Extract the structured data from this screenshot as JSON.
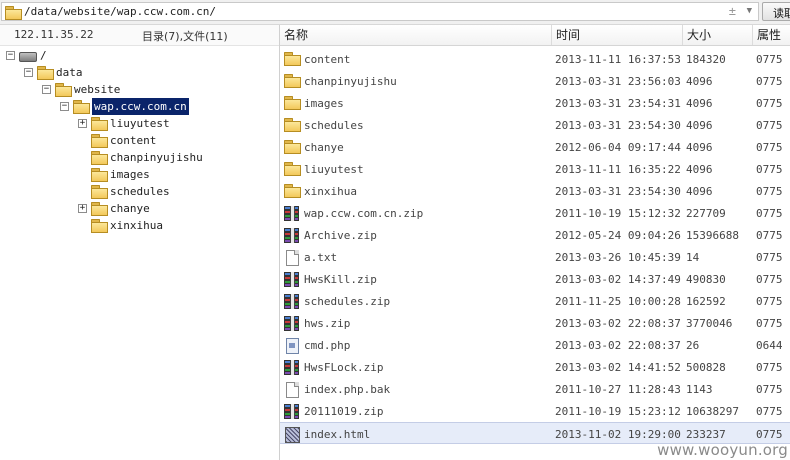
{
  "address_bar": {
    "path": "/data/website/wap.ccw.com.cn/",
    "plus_symbol": "±",
    "arrow_symbol": "▼",
    "read_button": "读取"
  },
  "left_panel": {
    "ip": "122.11.35.22",
    "dir_count": "目录(7),文件(11)",
    "tree": [
      {
        "label": "/",
        "icon": "drive-icon",
        "expander": "−",
        "selected": false
      },
      {
        "label": "data",
        "icon": "folder-icon",
        "expander": "−",
        "selected": false
      },
      {
        "label": "website",
        "icon": "folder-icon",
        "expander": "−",
        "selected": false
      },
      {
        "label": "wap.ccw.com.cn",
        "icon": "open-folder-icon",
        "expander": "−",
        "selected": true
      },
      {
        "label": "liuyutest",
        "icon": "folder-icon",
        "expander": "+",
        "selected": false
      },
      {
        "label": "content",
        "icon": "folder-icon",
        "expander": "",
        "selected": false
      },
      {
        "label": "chanpinyujishu",
        "icon": "folder-icon",
        "expander": "",
        "selected": false
      },
      {
        "label": "images",
        "icon": "folder-icon",
        "expander": "",
        "selected": false
      },
      {
        "label": "schedules",
        "icon": "folder-icon",
        "expander": "",
        "selected": false
      },
      {
        "label": "chanye",
        "icon": "folder-icon",
        "expander": "+",
        "selected": false
      },
      {
        "label": "xinxihua",
        "icon": "folder-icon",
        "expander": "",
        "selected": false
      }
    ]
  },
  "file_list": {
    "headers": {
      "name": "名称",
      "time": "时间",
      "size": "大小",
      "perm": "属性"
    },
    "rows": [
      {
        "icon": "folder-icon",
        "name": "content",
        "time": "2013-11-11 16:37:53",
        "size": "184320",
        "perm": "0775"
      },
      {
        "icon": "folder-icon",
        "name": "chanpinyujishu",
        "time": "2013-03-31 23:56:03",
        "size": "4096",
        "perm": "0775"
      },
      {
        "icon": "folder-icon",
        "name": "images",
        "time": "2013-03-31 23:54:31",
        "size": "4096",
        "perm": "0775"
      },
      {
        "icon": "folder-icon",
        "name": "schedules",
        "time": "2013-03-31 23:54:30",
        "size": "4096",
        "perm": "0775"
      },
      {
        "icon": "folder-icon",
        "name": "chanye",
        "time": "2012-06-04 09:17:44",
        "size": "4096",
        "perm": "0775"
      },
      {
        "icon": "folder-icon",
        "name": "liuyutest",
        "time": "2013-11-11 16:35:22",
        "size": "4096",
        "perm": "0775"
      },
      {
        "icon": "folder-icon",
        "name": "xinxihua",
        "time": "2013-03-31 23:54:30",
        "size": "4096",
        "perm": "0775"
      },
      {
        "icon": "archive-icon",
        "name": "wap.ccw.com.cn.zip",
        "time": "2011-10-19 15:12:32",
        "size": "227709",
        "perm": "0775"
      },
      {
        "icon": "archive-icon",
        "name": "Archive.zip",
        "time": "2012-05-24 09:04:26",
        "size": "15396688",
        "perm": "0775"
      },
      {
        "icon": "text-file-icon",
        "name": "a.txt",
        "time": "2013-03-26 10:45:39",
        "size": "14",
        "perm": "0775"
      },
      {
        "icon": "archive-icon",
        "name": "HwsKill.zip",
        "time": "2013-03-02 14:37:49",
        "size": "490830",
        "perm": "0775"
      },
      {
        "icon": "archive-icon",
        "name": "schedules.zip",
        "time": "2011-11-25 10:00:28",
        "size": "162592",
        "perm": "0775"
      },
      {
        "icon": "archive-icon",
        "name": "hws.zip",
        "time": "2013-03-02 22:08:37",
        "size": "3770046",
        "perm": "0775"
      },
      {
        "icon": "php-file-icon",
        "name": "cmd.php",
        "time": "2013-03-02 22:08:37",
        "size": "26",
        "perm": "0644"
      },
      {
        "icon": "archive-icon",
        "name": "HwsFLock.zip",
        "time": "2013-03-02 14:41:52",
        "size": "500828",
        "perm": "0775"
      },
      {
        "icon": "text-file-icon",
        "name": "index.php.bak",
        "time": "2011-10-27 11:28:43",
        "size": "1143",
        "perm": "0775"
      },
      {
        "icon": "archive-icon",
        "name": "20111019.zip",
        "time": "2011-10-19 15:23:12",
        "size": "10638297",
        "perm": "0775"
      },
      {
        "icon": "html-file-icon",
        "name": "index.html",
        "time": "2013-11-02 19:29:00",
        "size": "233237",
        "perm": "0775",
        "selected": true
      }
    ]
  },
  "watermark": "www.wooyun.org",
  "colors": {
    "selection": "#0a246a",
    "row_highlight": "#e6ecf9"
  }
}
